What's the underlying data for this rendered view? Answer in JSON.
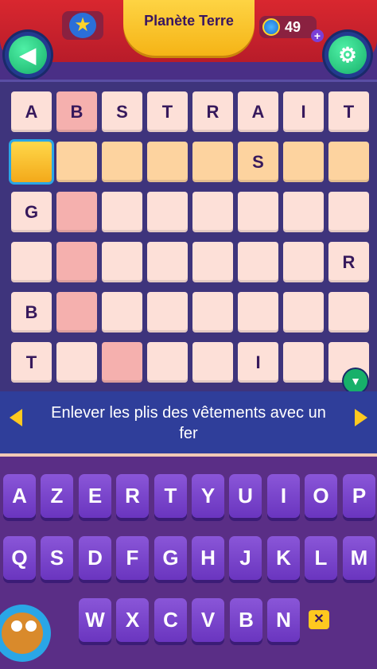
{
  "header": {
    "title": "Planète Terre",
    "coins": "49",
    "plus": "+",
    "back_icon": "back-arrow-icon",
    "settings_icon": "gear-icon"
  },
  "grid": {
    "rows": [
      [
        "A",
        "B",
        "S",
        "T",
        "R",
        "A",
        "I",
        "T"
      ],
      [
        "",
        "",
        "",
        "",
        "",
        "S",
        "",
        ""
      ],
      [
        "G",
        "",
        "",
        "",
        "",
        "",
        "",
        ""
      ],
      [
        "",
        "",
        "",
        "",
        "",
        "",
        "",
        "R"
      ],
      [
        "B",
        "",
        "",
        "",
        "",
        "",
        "",
        ""
      ],
      [
        "T",
        "",
        "",
        "",
        "",
        "I",
        "",
        ""
      ]
    ]
  },
  "clue": {
    "text": "Enlever les plis des vêtements avec un fer"
  },
  "keyboard": {
    "rows": [
      [
        "A",
        "Z",
        "E",
        "R",
        "T",
        "Y",
        "U",
        "I",
        "O",
        "P"
      ],
      [
        "Q",
        "S",
        "D",
        "F",
        "G",
        "H",
        "J",
        "K",
        "L",
        "M"
      ],
      [
        "W",
        "X",
        "C",
        "V",
        "B",
        "N"
      ]
    ],
    "delete_icon": "backspace-icon"
  },
  "colors": {
    "header_red": "#d9272f",
    "title_yellow": "#ffd84a",
    "board_bg": "#3e347c",
    "clue_bg": "#2f3e9a",
    "key_purple": "#7a45cc",
    "accent_green": "#17b06a"
  }
}
